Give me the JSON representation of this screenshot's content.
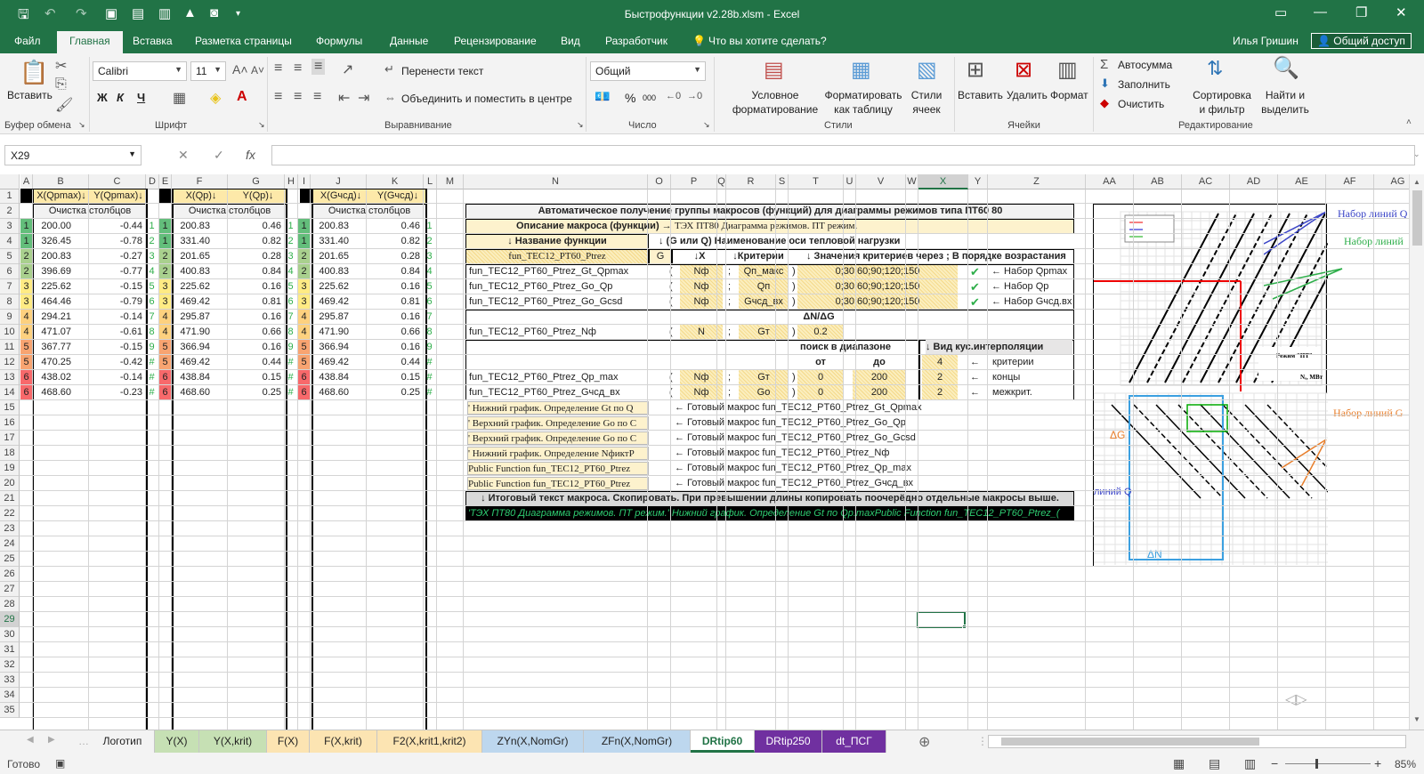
{
  "window": {
    "title": "Быстрофункции v2.28b.xlsm - Excel",
    "user": "Илья Гришин",
    "share": "Общий доступ"
  },
  "tabs": [
    "Файл",
    "Главная",
    "Вставка",
    "Разметка страницы",
    "Формулы",
    "Данные",
    "Рецензирование",
    "Вид",
    "Разработчик"
  ],
  "tell_me": "Что вы хотите сделать?",
  "ribbon": {
    "paste": "Вставить",
    "clipboard_group": "Буфер обмена",
    "font_name": "Calibri",
    "font_size": "11",
    "bold": "Ж",
    "italic": "К",
    "underline": "Ч",
    "font_group": "Шрифт",
    "wrap": "Перенести текст",
    "merge": "Объединить и поместить в центре",
    "align_group": "Выравнивание",
    "num_format": "Общий",
    "percent": "%",
    "thousands": "000",
    "number_group": "Число",
    "cond_fmt1": "Условное",
    "cond_fmt2": "форматирование",
    "fmt_table1": "Форматировать",
    "fmt_table2": "как таблицу",
    "cell_styles1": "Стили",
    "cell_styles2": "ячеек",
    "styles_group": "Стили",
    "insert": "Вставить",
    "delete": "Удалить",
    "format": "Формат",
    "cells_group": "Ячейки",
    "autosum": "Автосумма",
    "fill": "Заполнить",
    "clear": "Очистить",
    "sort1": "Сортировка",
    "sort2": "и фильтр",
    "find1": "Найти и",
    "find2": "выделить",
    "editing_group": "Редактирование"
  },
  "name_box": "X29",
  "columns": [
    "A",
    "B",
    "C",
    "D",
    "E",
    "F",
    "G",
    "H",
    "I",
    "J",
    "K",
    "L",
    "M",
    "N",
    "O",
    "P",
    "Q",
    "R",
    "S",
    "T",
    "U",
    "V",
    "W",
    "X",
    "Y",
    "Z",
    "AA",
    "AB",
    "AC",
    "AD",
    "AE",
    "AF",
    "AG"
  ],
  "rows": [
    "1",
    "2",
    "3",
    "4",
    "5",
    "6",
    "7",
    "8",
    "9",
    "10",
    "11",
    "12",
    "13",
    "14",
    "15",
    "16",
    "17",
    "18",
    "19",
    "20",
    "21",
    "22",
    "23",
    "24",
    "25",
    "26",
    "27",
    "28",
    "29",
    "30",
    "31",
    "32",
    "33",
    "34",
    "35"
  ],
  "block1": {
    "hx": "X(Qpmax)↓",
    "hy": "Y(Qpmax)↓",
    "clear": "Очистка столбцов",
    "rows": [
      [
        "1",
        "200.00",
        "-0.44"
      ],
      [
        "1",
        "326.45",
        "-0.78"
      ],
      [
        "2",
        "200.83",
        "-0.27"
      ],
      [
        "2",
        "396.69",
        "-0.77"
      ],
      [
        "3",
        "225.62",
        "-0.15"
      ],
      [
        "3",
        "464.46",
        "-0.79"
      ],
      [
        "4",
        "294.21",
        "-0.14"
      ],
      [
        "4",
        "471.07",
        "-0.61"
      ],
      [
        "5",
        "367.77",
        "-0.15"
      ],
      [
        "5",
        "470.25",
        "-0.42"
      ],
      [
        "6",
        "438.02",
        "-0.14"
      ],
      [
        "6",
        "468.60",
        "-0.23"
      ]
    ]
  },
  "block2": {
    "hx": "X(Qp)↓",
    "hy": "Y(Qp)↓",
    "clear": "Очистка столбцов",
    "dcol": [
      "1",
      "2",
      "3",
      "4",
      "5",
      "6",
      "7",
      "8",
      "9",
      "#",
      "#",
      "#"
    ],
    "rows": [
      [
        "1",
        "200.83",
        "0.46"
      ],
      [
        "1",
        "331.40",
        "0.82"
      ],
      [
        "2",
        "201.65",
        "0.28"
      ],
      [
        "2",
        "400.83",
        "0.84"
      ],
      [
        "3",
        "225.62",
        "0.16"
      ],
      [
        "3",
        "469.42",
        "0.81"
      ],
      [
        "4",
        "295.87",
        "0.16"
      ],
      [
        "4",
        "471.90",
        "0.66"
      ],
      [
        "5",
        "366.94",
        "0.16"
      ],
      [
        "5",
        "469.42",
        "0.44"
      ],
      [
        "6",
        "438.84",
        "0.15"
      ],
      [
        "6",
        "468.60",
        "0.25"
      ]
    ]
  },
  "block3": {
    "hx": "X(Gчсд)↓",
    "hy": "Y(Gчсд)↓",
    "clear": "Очистка столбцов",
    "hcol": [
      "1",
      "2",
      "3",
      "4",
      "5",
      "6",
      "7",
      "8",
      "9",
      "#",
      "#",
      "#"
    ],
    "lcol": [
      "1",
      "2",
      "3",
      "4",
      "5",
      "6",
      "7",
      "8",
      "9",
      "#",
      "#",
      "#"
    ],
    "rows": [
      [
        "1",
        "200.83",
        "0.46"
      ],
      [
        "1",
        "331.40",
        "0.82"
      ],
      [
        "2",
        "201.65",
        "0.28"
      ],
      [
        "2",
        "400.83",
        "0.84"
      ],
      [
        "3",
        "225.62",
        "0.16"
      ],
      [
        "3",
        "469.42",
        "0.81"
      ],
      [
        "4",
        "295.87",
        "0.16"
      ],
      [
        "4",
        "471.90",
        "0.66"
      ],
      [
        "5",
        "366.94",
        "0.16"
      ],
      [
        "5",
        "469.42",
        "0.44"
      ],
      [
        "6",
        "438.84",
        "0.15"
      ],
      [
        "6",
        "468.60",
        "0.25"
      ]
    ]
  },
  "macro": {
    "title": "Автоматическое получение группы макросов (функций) для диаграммы режимов типа ПТ60 80",
    "desc_label": "Описание макроса (функции) →",
    "desc_value": "ТЭХ ПТ80 Диаграмма режимов. ПТ режим.",
    "fname_label": "↓ Название функции",
    "fname_value": "fun_TEC12_PT60_Ptrez",
    "axis_label": "↓ (G или Q) Наименование оси тепловой нагрузки",
    "axis_value": "G",
    "col_x": "↓X",
    "col_crit": "↓Критерии",
    "col_vals": "↓ Значения критериев через ; В порядке возрастания",
    "funcs": [
      {
        "name": "fun_TEC12_PT60_Ptrez_Gt_Qpmax",
        "x": "Nф",
        "crit": "Qп_макс",
        "vals": "0;30;60;90;120;150",
        "check": "✔",
        "note": "← Набор Qpmax"
      },
      {
        "name": "fun_TEC12_PT60_Ptrez_Go_Qp",
        "x": "Nф",
        "crit": "Qп",
        "vals": "0;30;60;90;120;150",
        "check": "✔",
        "note": "← Набор Qp"
      },
      {
        "name": "fun_TEC12_PT60_Ptrez_Go_Gcsd",
        "x": "Nф",
        "crit": "Gчсд_вх",
        "vals": "0;30;60;90;120;150",
        "check": "✔",
        "note": "← Набор Gчсд.вх"
      }
    ],
    "dn_label": "ΔN/ΔG",
    "nf_name": "fun_TEC12_PT60_Ptrez_Nф",
    "nf_x": "N",
    "nf_crit": "Gт",
    "nf_val": "0.2",
    "search_label": "поиск в диапазоне",
    "from": "от",
    "to": "до",
    "interp_label": "↓ Вид кус.интерполяции",
    "ranges": [
      {
        "name": "fun_TEC12_PT60_Ptrez_Qp_max",
        "x": "Nф",
        "crit": "Gт",
        "from": "0",
        "to": "200",
        "k": "2",
        "klabel": "концы"
      },
      {
        "name": "fun_TEC12_PT60_Ptrez_Gчсд_вх",
        "x": "Nф",
        "crit": "Gо",
        "from": "0",
        "to": "200",
        "k": "2",
        "klabel": "межкрит."
      }
    ],
    "k_first": "4",
    "k_first_label": "критерии",
    "ready": [
      {
        "code": "' Нижний график. Определение Gt по Q",
        "msg": "← Готовый макрос  fun_TEC12_PT60_Ptrez_Gt_Qpmax"
      },
      {
        "code": "' Верхний график. Определение Go по C",
        "msg": "← Готовый макрос  fun_TEC12_PT60_Ptrez_Go_Qp"
      },
      {
        "code": "' Верхний график. Определение Go по C",
        "msg": "← Готовый макрос  fun_TEC12_PT60_Ptrez_Go_Gcsd"
      },
      {
        "code": "' Нижний график. Определение NфиктР",
        "msg": "← Готовый макрос  fun_TEC12_PT60_Ptrez_Nф"
      },
      {
        "code": "Public Function fun_TEC12_PT60_Ptrez",
        "msg": "← Готовый макрос  fun_TEC12_PT60_Ptrez_Qp_max"
      },
      {
        "code": "Public Function fun_TEC12_PT60_Ptrez",
        "msg": "← Готовый макрос  fun_TEC12_PT60_Ptrez_Gчсд_вх"
      }
    ],
    "final_label": "↓ Итоговый текст макроса. Скопировать. При превышении длины копировать поочерёдно отдельные макросы выше.",
    "final_text": "'ТЭХ ПТ80 Диаграмма режимов. ПТ режим.' Нижний график. Определение Gt по Qp.maxPublic Function fun_TEC12_PT60_Ptrez_("
  },
  "chart": {
    "set1": "Набор линий Q",
    "set2": "Набор линий",
    "set3": "Набор линий G",
    "dg": "ΔG",
    "dn": "ΔN",
    "q_left": "линий Q",
    "mode": "Режим \"ПТ\"",
    "nmw": "Nₑ, МВт"
  },
  "sheet_tabs": [
    "Логотип",
    "Y(X)",
    "Y(X,krit)",
    "F(X)",
    "F(X,krit)",
    "F2(X,krit1,krit2)",
    "ZYn(X,NomGr)",
    "ZFn(X,NomGr)",
    "DRtip60",
    "DRtip250",
    "dt_ПСГ"
  ],
  "status": {
    "ready": "Готово",
    "zoom": "85%"
  }
}
